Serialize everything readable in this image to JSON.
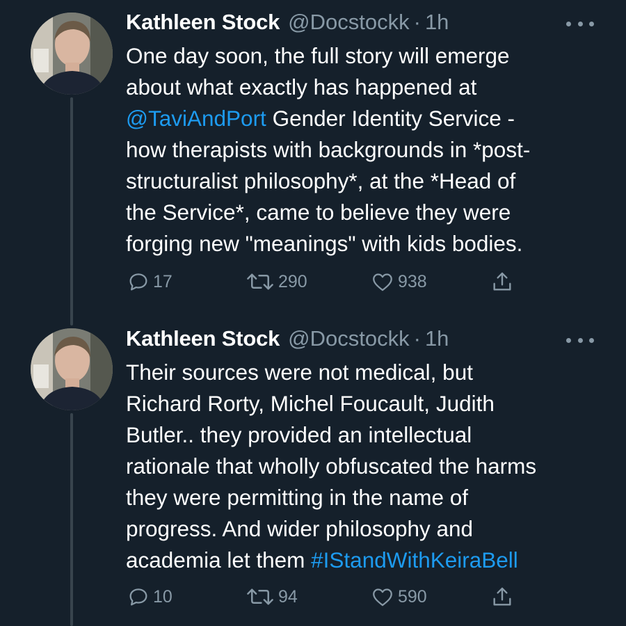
{
  "colors": {
    "background": "#15202b",
    "text": "#ffffff",
    "secondary": "#8899a6",
    "link": "#1d9bf0",
    "thread_line": "#38444d"
  },
  "tweets": [
    {
      "author": {
        "name": "Kathleen Stock",
        "handle": "@Docstockk",
        "separator": "·",
        "time": "1h"
      },
      "lines": [
        [
          {
            "text": "One day soon, the full story will emerge"
          }
        ],
        [
          {
            "text": "about what exactly has happened at"
          }
        ],
        [
          {
            "text": "@TaviAndPort",
            "link": true
          },
          {
            "text": " Gender Identity Service -"
          }
        ],
        [
          {
            "text": "how therapists with backgrounds in *post-"
          }
        ],
        [
          {
            "text": "structuralist philosophy*, at the *Head of"
          }
        ],
        [
          {
            "text": "the Service*, came to believe  they were"
          }
        ],
        [
          {
            "text": "forging new \"meanings\" with kids bodies."
          }
        ]
      ],
      "stats": {
        "replies": "17",
        "retweets": "290",
        "likes": "938"
      }
    },
    {
      "author": {
        "name": "Kathleen Stock",
        "handle": "@Docstockk",
        "separator": "·",
        "time": "1h"
      },
      "lines": [
        [
          {
            "text": "Their sources were not medical, but"
          }
        ],
        [
          {
            "text": "Richard Rorty, Michel Foucault, Judith"
          }
        ],
        [
          {
            "text": "Butler.. they provided an intellectual"
          }
        ],
        [
          {
            "text": "rationale that wholly obfuscated the harms"
          }
        ],
        [
          {
            "text": "they were permitting in the name of"
          }
        ],
        [
          {
            "text": "progress. And wider philosophy and"
          }
        ],
        [
          {
            "text": "academia let them "
          },
          {
            "text": "#IStandWithKeiraBell",
            "link": true
          }
        ]
      ],
      "stats": {
        "replies": "10",
        "retweets": "94",
        "likes": "590"
      }
    }
  ]
}
